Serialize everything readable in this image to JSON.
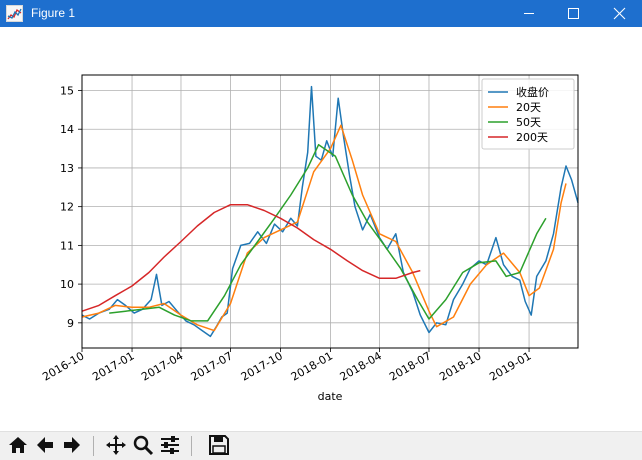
{
  "window": {
    "title": "Figure 1",
    "icon": "matplotlib-figure-icon",
    "controls": [
      "minimize-icon",
      "maximize-icon",
      "close-icon"
    ]
  },
  "toolbar": {
    "buttons": [
      "home-icon",
      "back-arrow-icon",
      "forward-arrow-icon",
      "pan-move-icon",
      "zoom-magnifier-icon",
      "configure-subplots-icon",
      "save-floppy-icon"
    ]
  },
  "chart_data": {
    "type": "line",
    "title": "",
    "xlabel": "date",
    "ylabel": "",
    "xlim": [
      "2016-10-01",
      "2019-04-01"
    ],
    "ylim": [
      8.35,
      15.4
    ],
    "x_tick_labels": [
      "2016-10",
      "2017-01",
      "2017-04",
      "2017-07",
      "2017-10",
      "2018-01",
      "2018-04",
      "2018-07",
      "2018-10",
      "2019-01"
    ],
    "y_ticks": [
      9,
      10,
      11,
      12,
      13,
      14,
      15
    ],
    "grid": true,
    "legend_position": "upper right",
    "series": [
      {
        "name": "收盘价",
        "color": "#1f77b4",
        "points": [
          [
            "2016-10-01",
            9.2
          ],
          [
            "2016-10-15",
            9.1
          ],
          [
            "2016-11-01",
            9.25
          ],
          [
            "2016-11-20",
            9.35
          ],
          [
            "2016-12-05",
            9.6
          ],
          [
            "2016-12-20",
            9.45
          ],
          [
            "2017-01-05",
            9.25
          ],
          [
            "2017-01-20",
            9.35
          ],
          [
            "2017-02-05",
            9.6
          ],
          [
            "2017-02-15",
            10.25
          ],
          [
            "2017-02-25",
            9.45
          ],
          [
            "2017-03-10",
            9.55
          ],
          [
            "2017-03-25",
            9.3
          ],
          [
            "2017-04-10",
            9.05
          ],
          [
            "2017-04-25",
            8.95
          ],
          [
            "2017-05-10",
            8.8
          ],
          [
            "2017-05-25",
            8.65
          ],
          [
            "2017-06-05",
            8.9
          ],
          [
            "2017-06-15",
            9.15
          ],
          [
            "2017-06-25",
            9.25
          ],
          [
            "2017-07-05",
            10.4
          ],
          [
            "2017-07-20",
            11.0
          ],
          [
            "2017-08-05",
            11.05
          ],
          [
            "2017-08-20",
            11.35
          ],
          [
            "2017-09-05",
            11.05
          ],
          [
            "2017-09-20",
            11.55
          ],
          [
            "2017-10-05",
            11.35
          ],
          [
            "2017-10-20",
            11.7
          ],
          [
            "2017-11-01",
            11.5
          ],
          [
            "2017-11-10",
            12.5
          ],
          [
            "2017-11-20",
            13.4
          ],
          [
            "2017-11-27",
            15.1
          ],
          [
            "2017-12-05",
            13.3
          ],
          [
            "2017-12-15",
            13.2
          ],
          [
            "2017-12-25",
            13.7
          ],
          [
            "2018-01-05",
            13.3
          ],
          [
            "2018-01-15",
            14.8
          ],
          [
            "2018-01-25",
            13.8
          ],
          [
            "2018-02-05",
            12.8
          ],
          [
            "2018-02-15",
            12.0
          ],
          [
            "2018-03-01",
            11.4
          ],
          [
            "2018-03-15",
            11.8
          ],
          [
            "2018-04-01",
            11.2
          ],
          [
            "2018-04-15",
            10.9
          ],
          [
            "2018-05-01",
            11.3
          ],
          [
            "2018-05-15",
            10.3
          ],
          [
            "2018-06-01",
            9.8
          ],
          [
            "2018-06-15",
            9.2
          ],
          [
            "2018-07-01",
            8.75
          ],
          [
            "2018-07-15",
            9.0
          ],
          [
            "2018-08-01",
            8.95
          ],
          [
            "2018-08-15",
            9.6
          ],
          [
            "2018-09-01",
            10.0
          ],
          [
            "2018-09-15",
            10.4
          ],
          [
            "2018-10-01",
            10.6
          ],
          [
            "2018-10-15",
            10.5
          ],
          [
            "2018-11-01",
            11.2
          ],
          [
            "2018-11-15",
            10.5
          ],
          [
            "2018-12-01",
            10.2
          ],
          [
            "2018-12-15",
            10.1
          ],
          [
            "2018-12-25",
            9.55
          ],
          [
            "2019-01-05",
            9.2
          ],
          [
            "2019-01-15",
            10.2
          ],
          [
            "2019-02-01",
            10.6
          ],
          [
            "2019-02-15",
            11.3
          ],
          [
            "2019-03-01",
            12.5
          ],
          [
            "2019-03-10",
            13.05
          ],
          [
            "2019-03-20",
            12.7
          ],
          [
            "2019-04-01",
            12.1
          ]
        ]
      },
      {
        "name": "20天",
        "color": "#ff7f0e",
        "points": [
          [
            "2016-10-01",
            9.15
          ],
          [
            "2016-11-01",
            9.25
          ],
          [
            "2016-12-01",
            9.45
          ],
          [
            "2017-01-01",
            9.4
          ],
          [
            "2017-02-01",
            9.4
          ],
          [
            "2017-03-01",
            9.5
          ],
          [
            "2017-04-01",
            9.2
          ],
          [
            "2017-05-01",
            8.95
          ],
          [
            "2017-06-01",
            8.8
          ],
          [
            "2017-07-01",
            9.5
          ],
          [
            "2017-08-01",
            10.8
          ],
          [
            "2017-09-01",
            11.2
          ],
          [
            "2017-10-01",
            11.4
          ],
          [
            "2017-11-01",
            11.6
          ],
          [
            "2017-12-01",
            12.9
          ],
          [
            "2018-01-01",
            13.5
          ],
          [
            "2018-01-20",
            14.1
          ],
          [
            "2018-02-10",
            13.2
          ],
          [
            "2018-03-01",
            12.3
          ],
          [
            "2018-04-01",
            11.3
          ],
          [
            "2018-05-01",
            11.1
          ],
          [
            "2018-06-01",
            10.3
          ],
          [
            "2018-07-01",
            9.3
          ],
          [
            "2018-07-15",
            8.9
          ],
          [
            "2018-08-15",
            9.15
          ],
          [
            "2018-09-15",
            10.0
          ],
          [
            "2018-10-15",
            10.5
          ],
          [
            "2018-11-15",
            10.8
          ],
          [
            "2018-12-15",
            10.3
          ],
          [
            "2019-01-01",
            9.7
          ],
          [
            "2019-01-20",
            9.9
          ],
          [
            "2019-02-15",
            10.9
          ],
          [
            "2019-03-01",
            12.1
          ],
          [
            "2019-03-10",
            12.6
          ]
        ]
      },
      {
        "name": "50天",
        "color": "#2ca02c",
        "points": [
          [
            "2016-11-20",
            9.25
          ],
          [
            "2016-12-20",
            9.3
          ],
          [
            "2017-01-20",
            9.35
          ],
          [
            "2017-02-20",
            9.4
          ],
          [
            "2017-03-20",
            9.2
          ],
          [
            "2017-04-20",
            9.05
          ],
          [
            "2017-05-20",
            9.05
          ],
          [
            "2017-06-20",
            9.7
          ],
          [
            "2017-07-20",
            10.5
          ],
          [
            "2017-08-20",
            11.1
          ],
          [
            "2017-09-20",
            11.7
          ],
          [
            "2017-10-20",
            12.3
          ],
          [
            "2017-11-20",
            13.0
          ],
          [
            "2017-12-10",
            13.6
          ],
          [
            "2018-01-10",
            13.3
          ],
          [
            "2018-02-10",
            12.3
          ],
          [
            "2018-03-10",
            11.6
          ],
          [
            "2018-04-10",
            11.0
          ],
          [
            "2018-05-10",
            10.4
          ],
          [
            "2018-06-10",
            9.6
          ],
          [
            "2018-07-01",
            9.1
          ],
          [
            "2018-08-01",
            9.6
          ],
          [
            "2018-09-01",
            10.3
          ],
          [
            "2018-10-01",
            10.55
          ],
          [
            "2018-11-01",
            10.6
          ],
          [
            "2018-11-20",
            10.2
          ],
          [
            "2018-12-15",
            10.3
          ],
          [
            "2019-01-15",
            11.3
          ],
          [
            "2019-02-01",
            11.7
          ]
        ]
      },
      {
        "name": "200天",
        "color": "#d62728",
        "points": [
          [
            "2016-10-01",
            9.3
          ],
          [
            "2016-11-01",
            9.45
          ],
          [
            "2016-12-01",
            9.7
          ],
          [
            "2017-01-01",
            9.95
          ],
          [
            "2017-02-01",
            10.3
          ],
          [
            "2017-03-01",
            10.7
          ],
          [
            "2017-04-01",
            11.1
          ],
          [
            "2017-05-01",
            11.5
          ],
          [
            "2017-06-01",
            11.85
          ],
          [
            "2017-07-01",
            12.05
          ],
          [
            "2017-08-01",
            12.05
          ],
          [
            "2017-09-01",
            11.9
          ],
          [
            "2017-10-01",
            11.7
          ],
          [
            "2017-11-01",
            11.45
          ],
          [
            "2017-12-01",
            11.15
          ],
          [
            "2018-01-01",
            10.9
          ],
          [
            "2018-02-01",
            10.6
          ],
          [
            "2018-03-01",
            10.35
          ],
          [
            "2018-04-01",
            10.15
          ],
          [
            "2018-05-01",
            10.15
          ],
          [
            "2018-06-01",
            10.3
          ],
          [
            "2018-06-15",
            10.35
          ]
        ]
      }
    ]
  }
}
